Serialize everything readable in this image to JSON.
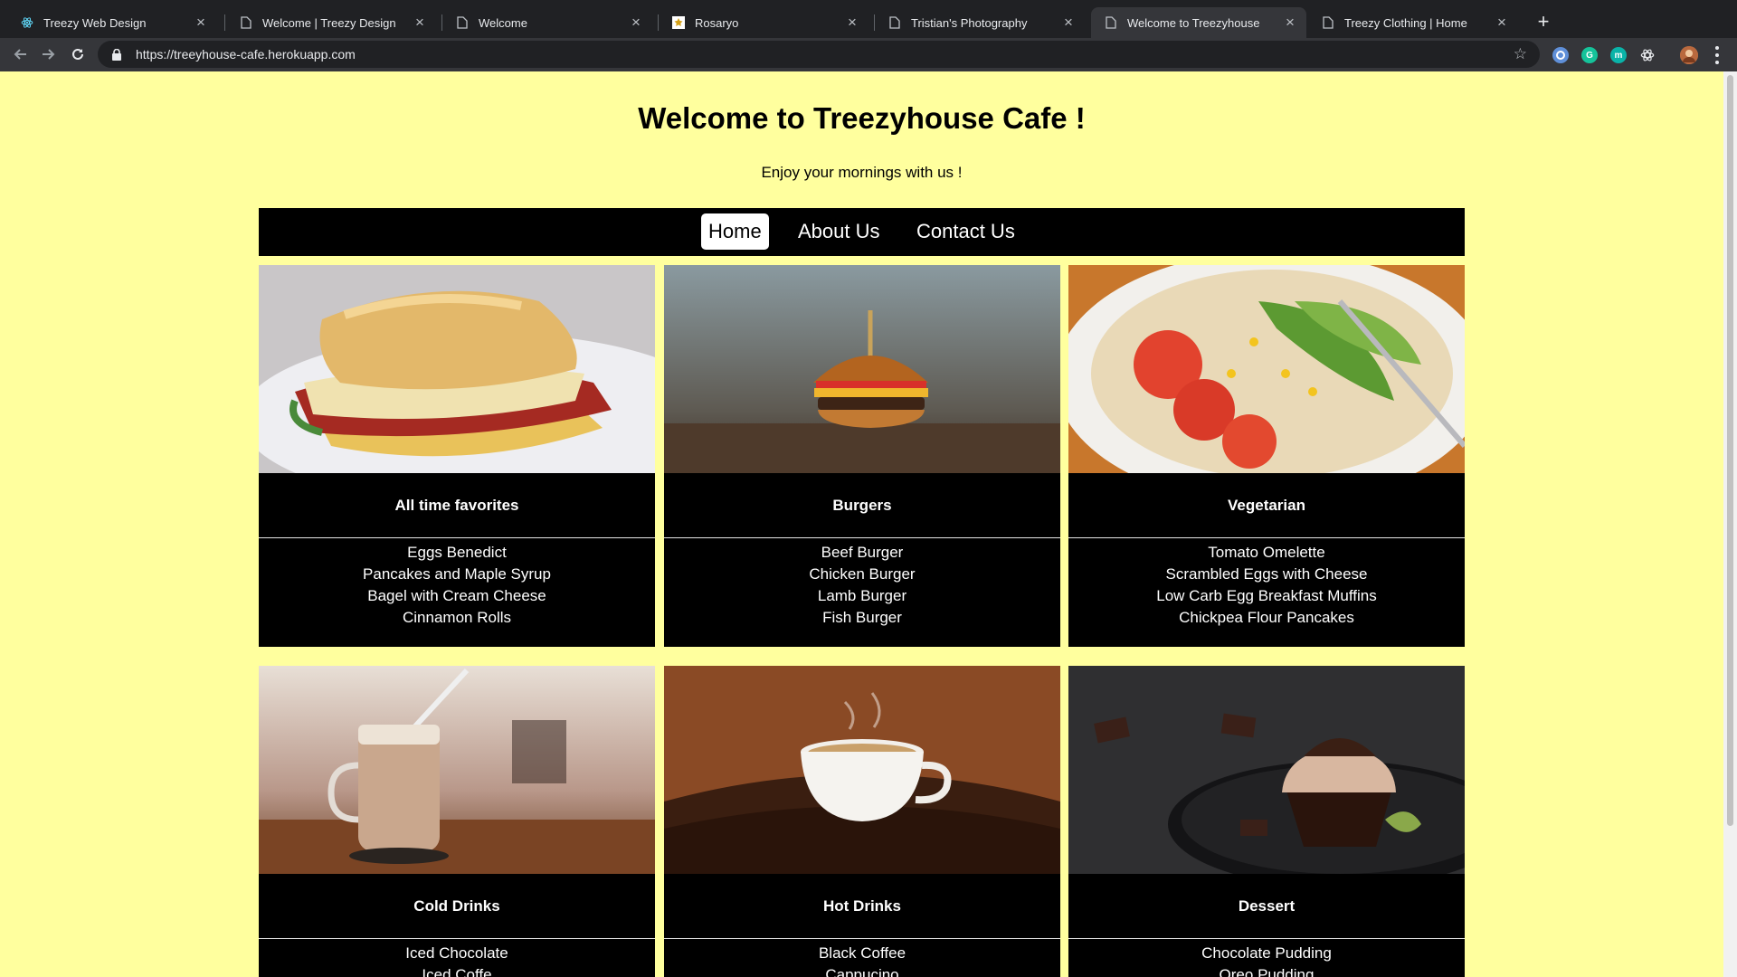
{
  "browser": {
    "tabs": [
      {
        "title": "Treezy Web Design",
        "icon": "react-icon",
        "active": false
      },
      {
        "title": "Welcome | Treezy Design",
        "icon": "page-icon",
        "active": false
      },
      {
        "title": "Welcome",
        "icon": "page-icon",
        "active": false
      },
      {
        "title": "Rosaryo",
        "icon": "rosaryo-icon",
        "active": false
      },
      {
        "title": "Tristian's Photography",
        "icon": "page-icon",
        "active": false
      },
      {
        "title": "Welcome to Treezyhouse",
        "icon": "page-icon",
        "active": true
      },
      {
        "title": "Treezy Clothing | Home",
        "icon": "page-icon",
        "active": false
      }
    ],
    "url": "https://treeyhouse-cafe.herokuapp.com",
    "extensions": [
      "extension-icon",
      "grammarly-icon",
      "mercury-icon",
      "react-devtools-icon",
      "profile-avatar"
    ]
  },
  "page": {
    "title": "Welcome to Treezyhouse Cafe !",
    "subtitle": "Enjoy your mornings with us !",
    "nav": [
      {
        "label": "Home",
        "active": true
      },
      {
        "label": "About Us",
        "active": false
      },
      {
        "label": "Contact Us",
        "active": false
      }
    ],
    "categories": [
      {
        "name": "All time favorites",
        "image": "breakfast sandwich",
        "items": [
          "Eggs Benedict",
          "Pancakes and Maple Syrup",
          "Bagel with Cream Cheese",
          "Cinnamon Rolls"
        ]
      },
      {
        "name": "Burgers",
        "image": "burger",
        "items": [
          "Beef Burger",
          "Chicken Burger",
          "Lamb Burger",
          "Fish Burger"
        ]
      },
      {
        "name": "Vegetarian",
        "image": "tomato avocado plate",
        "items": [
          "Tomato Omelette",
          "Scrambled Eggs with Cheese",
          "Low Carb Egg Breakfast Muffins",
          "Chickpea Flour Pancakes"
        ]
      },
      {
        "name": "Cold Drinks",
        "image": "iced chocolate jar",
        "items": [
          "Iced Chocolate",
          "Iced Coffe"
        ]
      },
      {
        "name": "Hot Drinks",
        "image": "coffee cup on beans",
        "items": [
          "Black Coffee",
          "Cappucino"
        ]
      },
      {
        "name": "Dessert",
        "image": "chocolate cupcake",
        "items": [
          "Chocolate Pudding",
          "Oreo Pudding"
        ]
      }
    ]
  },
  "colors": {
    "page_background": "#ffff9e",
    "nav_background": "#000000",
    "card_background": "#000000",
    "chrome_dark": "#202124",
    "chrome_toolbar": "#35363a"
  }
}
